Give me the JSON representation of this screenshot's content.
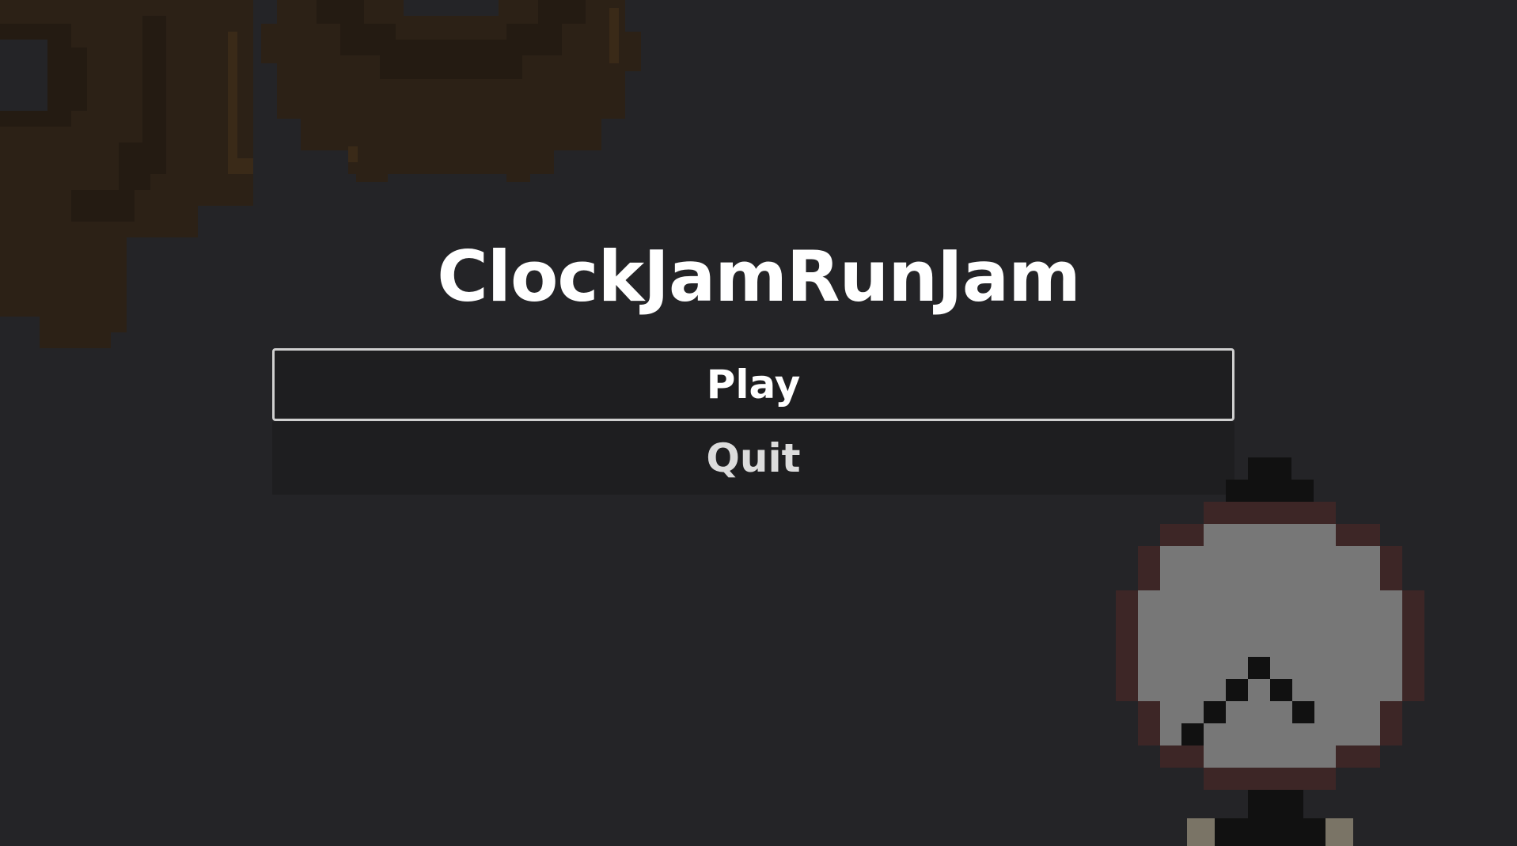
{
  "game": {
    "title": "ClockJamRunJam"
  },
  "menu": {
    "items": [
      {
        "label": "Play",
        "focused": true
      },
      {
        "label": "Quit",
        "focused": false
      }
    ]
  },
  "colors": {
    "background": "#242427",
    "gear": "#2c2116",
    "gear_shadow": "#241b12",
    "gear_highlight": "#3a2a18",
    "clock_rim": "#3d2626",
    "clock_face": "#777777",
    "clock_hands": "#111111",
    "button_bg": "#1e1e20",
    "button_border": "#cfcfcf"
  },
  "icons": {
    "gears_decoration": "gear-icon",
    "player_sprite": "clock-character-icon"
  }
}
